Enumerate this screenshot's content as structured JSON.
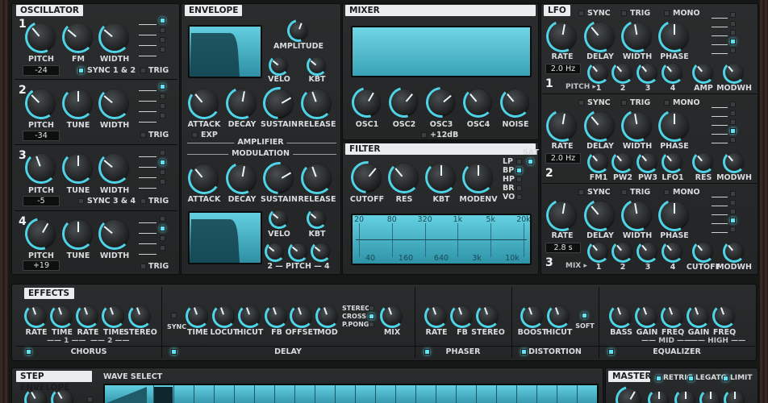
{
  "accent_color": "#4fd3e6",
  "display_color": "#4fc2d6",
  "oscillator": {
    "title": "OSCILLATOR",
    "osc1": {
      "number": "1",
      "pitch_label": "PITCH",
      "fm_label": "FM",
      "width_label": "WIDTH",
      "pitch_value": "-24",
      "sync_label": "SYNC 1 & 2",
      "trig_label": "TRIG"
    },
    "osc2": {
      "number": "2",
      "pitch_label": "PITCH",
      "tune_label": "TUNE",
      "width_label": "WIDTH",
      "pitch_value": "-34",
      "trig_label": "TRIG"
    },
    "osc3": {
      "number": "3",
      "pitch_label": "PITCH",
      "tune_label": "TUNE",
      "width_label": "WIDTH",
      "pitch_value": "-5",
      "sync_label": "SYNC 3 & 4",
      "trig_label": "TRIG"
    },
    "osc4": {
      "number": "4",
      "pitch_label": "PITCH",
      "tune_label": "TUNE",
      "width_label": "WIDTH",
      "pitch_value": "+19",
      "trig_label": "TRIG"
    }
  },
  "envelope": {
    "title": "ENVELOPE",
    "amplitude_label": "AMPLITUDE",
    "velo_label": "VELO",
    "kbt_label": "KBT",
    "amp": {
      "attack": "ATTACK",
      "decay": "DECAY",
      "sustain": "SUSTAIN",
      "release": "RELEASE"
    },
    "exp_label": "EXP",
    "amplifier_label": "AMPLIFIER",
    "modulation_label": "MODULATION",
    "mod": {
      "attack": "ATTACK",
      "decay": "DECAY",
      "sustain": "SUSTAIN",
      "release": "RELEASE"
    },
    "pitch_range_label": "2 — PITCH — 4"
  },
  "mixer": {
    "title": "MIXER",
    "channels": [
      "OSC1",
      "OSC2",
      "OSC3",
      "OSC4",
      "NOISE"
    ],
    "boost_label": "+12dB"
  },
  "filter": {
    "title": "FILTER",
    "sat_label": "SAT",
    "types": [
      "LP",
      "BP",
      "HP",
      "BR",
      "VO"
    ],
    "cutoff_label": "CUTOFF",
    "res_label": "RES",
    "kbt_label": "KBT",
    "modenv_label": "MODENV",
    "freq_top": [
      "20",
      "80",
      "320",
      "1k",
      "5k",
      "20k"
    ],
    "freq_bottom": [
      "40",
      "160",
      "640",
      "3k",
      "10k"
    ]
  },
  "lfo": {
    "title": "LFO",
    "rows": [
      {
        "number": "1",
        "sync": "SYNC",
        "trig": "TRIG",
        "mono": "MONO",
        "knobs": [
          "RATE",
          "DELAY",
          "WIDTH",
          "PHASE"
        ],
        "rate_value": "2.0 Hz",
        "route_label": "PITCH ▸",
        "routes": [
          "1",
          "2",
          "3",
          "4",
          "AMP",
          "MODWH"
        ]
      },
      {
        "number": "2",
        "sync": "SYNC",
        "trig": "TRIG",
        "mono": "MONO",
        "knobs": [
          "RATE",
          "DELAY",
          "WIDTH",
          "PHASE"
        ],
        "rate_value": "2.0 Hz",
        "route_label": "",
        "routes": [
          "FM1",
          "PW2",
          "PW3",
          "LFO1",
          "RES",
          "MODWH"
        ]
      },
      {
        "number": "3",
        "sync": "SYNC",
        "trig": "TRIG",
        "mono": "MONO",
        "knobs": [
          "RATE",
          "DELAY",
          "WIDTH",
          "PHASE"
        ],
        "rate_value": "2.8 s",
        "route_label": "MIX ▸",
        "routes": [
          "1",
          "2",
          "3",
          "4",
          "CUTOFF",
          "MODWH"
        ]
      }
    ]
  },
  "effects": {
    "title": "EFFECTS",
    "chorus": {
      "knobs": [
        "RATE",
        "TIME",
        "RATE",
        "TIME",
        "STEREO"
      ],
      "group1": "1",
      "group2": "2",
      "name": "CHORUS"
    },
    "delay": {
      "sync_label": "SYNC",
      "knobs": [
        "TIME",
        "LOCUT",
        "HICUT",
        "FB",
        "OFFSET",
        "MOD"
      ],
      "modes": [
        "STEREO",
        "CROSS",
        "P.PONG"
      ],
      "mix_label": "MIX",
      "name": "DELAY"
    },
    "phaser": {
      "knobs": [
        "RATE",
        "FB",
        "STEREO"
      ],
      "name": "PHASER"
    },
    "distortion": {
      "knobs": [
        "BOOST",
        "HICUT"
      ],
      "soft_label": "SOFT",
      "name": "DISTORTION"
    },
    "equalizer": {
      "knobs": [
        "BASS",
        "GAIN",
        "FREQ",
        "GAIN",
        "FREQ"
      ],
      "mid_label": "MID",
      "high_label": "HIGH",
      "name": "EQUALIZER"
    }
  },
  "step_envelope": {
    "title": "STEP ENVELOPE",
    "wave_select_label": "WAVE SELECT",
    "steps": [
      0.9,
      0.0,
      0.0,
      0.0,
      0.0,
      0.0,
      0.0,
      0.0,
      0.0,
      0.0,
      0.0,
      0.0,
      0.0,
      0.0,
      0.0,
      0.0,
      0.0,
      0.0,
      0.0,
      0.0,
      0.0,
      0.0
    ]
  },
  "master": {
    "title": "MASTER",
    "retrig_label": "RETRIG",
    "legato_label": "LEGATO",
    "limit_label": "LIMIT"
  }
}
